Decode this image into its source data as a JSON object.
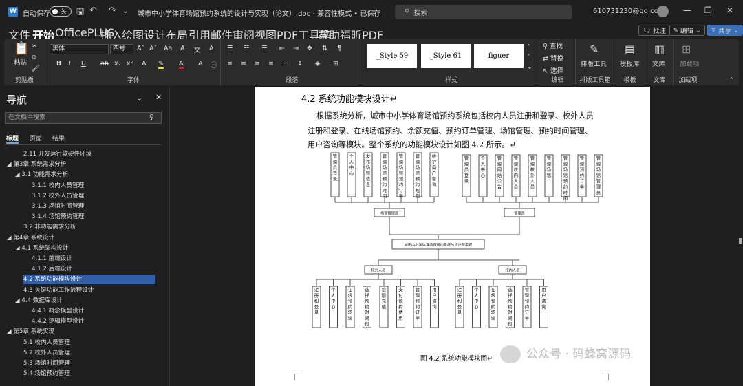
{
  "titlebar": {
    "autosave_label": "自动保存",
    "autosave_state": "关",
    "doc_title": "城市中小学体育场馆预约系统的设计与实现（论文）.doc - 兼容性模式 • 已保存",
    "search_placeholder": "搜索",
    "account": "610731230@qq.com"
  },
  "menu": {
    "items": [
      "文件",
      "开始",
      "OfficePLUS",
      "插入",
      "绘图",
      "设计",
      "布局",
      "引用",
      "邮件",
      "审阅",
      "视图",
      "PDF工具箱",
      "帮助",
      "福昕PDF"
    ],
    "comment_btn": "批注",
    "edit_btn": "编辑",
    "share_btn": "共享"
  },
  "ribbon": {
    "clipboard": {
      "paste": "粘贴",
      "label": "剪贴板"
    },
    "font": {
      "name": "黑体",
      "size": "四号",
      "label": "字体"
    },
    "paragraph": {
      "label": "段落"
    },
    "styles": {
      "items": [
        "_Style 59",
        "_Style 61",
        "figuer"
      ],
      "label": "样式"
    },
    "editing": {
      "find": "查找",
      "replace": "替换",
      "select": "选择",
      "label": "编辑"
    },
    "layout_tool": {
      "btn": "排版工具",
      "label": "排版工具箱"
    },
    "template": {
      "btn": "模板库",
      "label": "模板"
    },
    "library": {
      "btn": "文库",
      "label": "文库"
    },
    "addins": {
      "btn": "加载项",
      "label": "加载项"
    }
  },
  "nav": {
    "title": "导航",
    "search_placeholder": "在文档中搜索",
    "tabs": [
      "标题",
      "页面",
      "结果"
    ],
    "items": [
      {
        "text": "2.11 开发运行软硬件环境",
        "level": 2,
        "sel": false
      },
      {
        "text": "◢ 第3章 系统需求分析",
        "level": 0,
        "sel": false
      },
      {
        "text": "◢ 3.1 功能需求分析",
        "level": 1,
        "sel": false
      },
      {
        "text": "3.1.1 校内人员管理",
        "level": 3,
        "sel": false
      },
      {
        "text": "3.1.2 校外人员管理",
        "level": 3,
        "sel": false
      },
      {
        "text": "3.1.3 场馆时间管理",
        "level": 3,
        "sel": false
      },
      {
        "text": "3.1.4 场馆预约管理",
        "level": 3,
        "sel": false
      },
      {
        "text": "3.2 非功能需求分析",
        "level": 2,
        "sel": false
      },
      {
        "text": "◢ 第4章 系统设计",
        "level": 0,
        "sel": false
      },
      {
        "text": "◢ 4.1 系统架构设计",
        "level": 1,
        "sel": false
      },
      {
        "text": "4.1.1 前端设计",
        "level": 3,
        "sel": false
      },
      {
        "text": "4.1.2 后端设计",
        "level": 3,
        "sel": false
      },
      {
        "text": "4.2 系统功能模块设计",
        "level": 2,
        "sel": true
      },
      {
        "text": "4.3 关键功能工作流程设计",
        "level": 2,
        "sel": false
      },
      {
        "text": "◢ 4.4 数据库设计",
        "level": 1,
        "sel": false
      },
      {
        "text": "4.4.1 概念模型设计",
        "level": 3,
        "sel": false
      },
      {
        "text": "4.4.2 逻辑模型设计",
        "level": 3,
        "sel": false
      },
      {
        "text": "◢ 第5章 系统实现",
        "level": 0,
        "sel": false
      },
      {
        "text": "5.1 校内人员管理",
        "level": 2,
        "sel": false
      },
      {
        "text": "5.2 校外人员管理",
        "level": 2,
        "sel": false
      },
      {
        "text": "5.3 场馆时间管理",
        "level": 2,
        "sel": false
      },
      {
        "text": "5.4 场馆预约管理",
        "level": 2,
        "sel": false
      }
    ]
  },
  "document": {
    "heading": "4.2   系统功能模块设计↵",
    "para_lines": [
      "根据系统分析，城市中小学体育场馆预约系统包括校内人员注册和登录、校外人员",
      "注册和登录、在线场馆预约、余额充值、预约订单管理、场馆管理、预约时间管理、",
      "用户咨询等模块。整个系统的功能模块设计如图 4.2 所示。↵"
    ],
    "diagram": {
      "root": "城市中小学体育场馆预约系统的设计与实现",
      "top_left_parent": "场馆管理员",
      "top_left_children": [
        "管理员登录",
        "个人中心",
        "发布场馆信息",
        "管理场馆预约时间",
        "管理场馆预约订单",
        "管理场馆预约规则",
        "维护用户咨询"
      ],
      "top_right_parent": "管理员",
      "top_right_children": [
        "管理员登录",
        "个人中心",
        "管理网站公告",
        "管理校内人员",
        "管理校外人员",
        "管理场馆",
        "管理场馆预约时间",
        "管理预约订单",
        "管理场馆管理员"
      ],
      "bottom_left_parent": "校外人员",
      "bottom_left_children": [
        "注册和登录",
        "个人中心",
        "在线预约场馆",
        "选择预约时间段",
        "余额充值",
        "支付预约费用",
        "管理预约订单",
        "用户咨询"
      ],
      "bottom_right_parent": "校内人员",
      "bottom_right_children": [
        "注册和登录",
        "个人中心",
        "在线预约场馆",
        "选择预约时间段",
        "管理预约订单",
        "用户咨询"
      ]
    },
    "caption": "图 4.2  系统功能模块图↵"
  },
  "watermark": "公众号 · 码蜂窝源码"
}
